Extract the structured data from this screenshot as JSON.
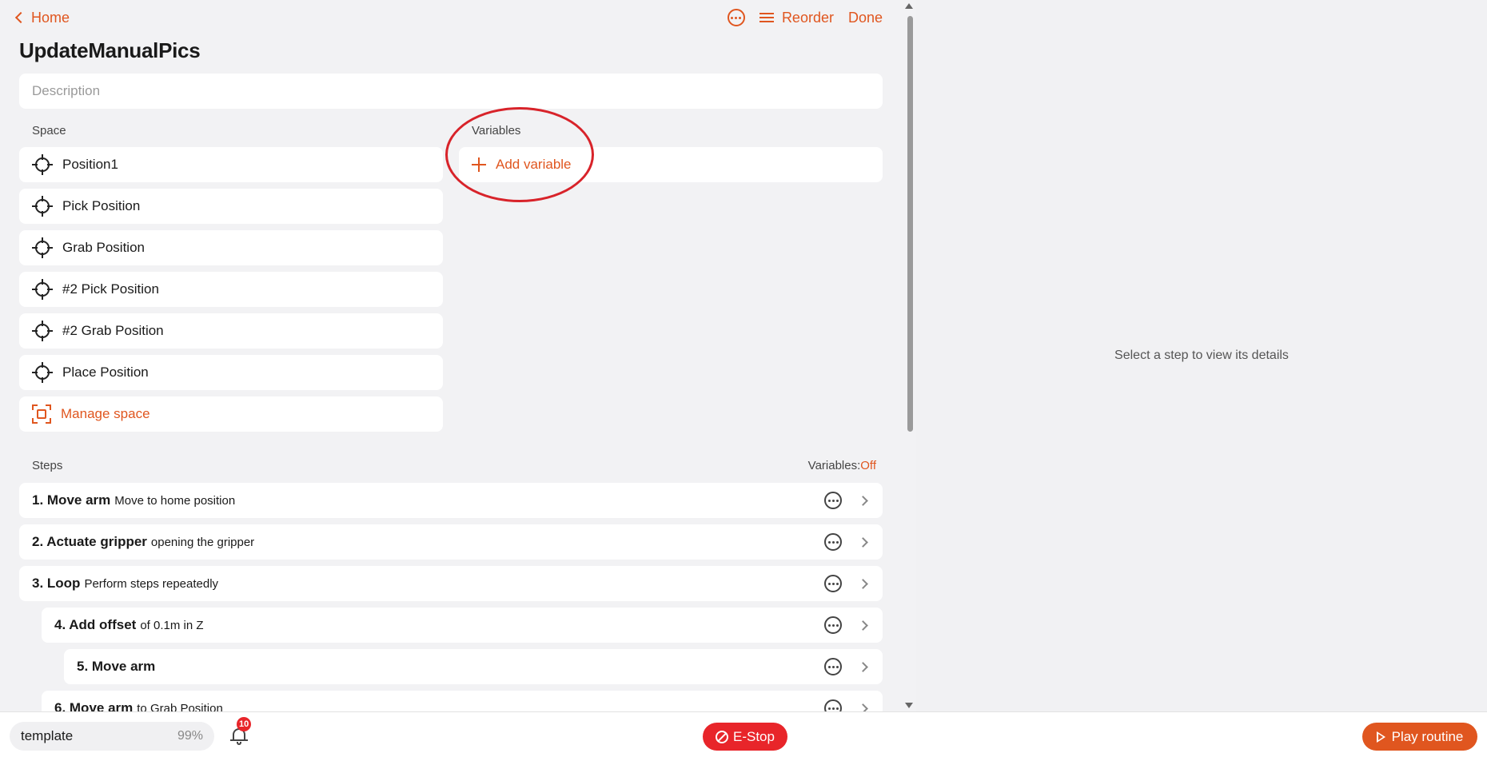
{
  "nav": {
    "home_label": "Home",
    "reorder_label": "Reorder",
    "done_label": "Done"
  },
  "routine": {
    "title": "UpdateManualPics",
    "description_placeholder": "Description"
  },
  "space": {
    "label": "Space",
    "positions": [
      "Position1",
      "Pick Position",
      "Grab Position",
      "#2 Pick Position",
      "#2 Grab Position",
      "Place Position"
    ],
    "manage_label": "Manage space"
  },
  "variables": {
    "label": "Variables",
    "add_label": "Add variable"
  },
  "steps": {
    "label": "Steps",
    "variables_toggle_label": "Variables:",
    "variables_toggle_value": "Off",
    "items": [
      {
        "title": "1. Move arm",
        "detail": "Move to home position"
      },
      {
        "title": "2. Actuate gripper",
        "detail": "opening the gripper"
      },
      {
        "title": "3. Loop",
        "detail": "Perform steps repeatedly"
      },
      {
        "title": "4. Add offset",
        "detail": "of 0.1m in Z"
      },
      {
        "title": "5. Move arm",
        "detail": ""
      },
      {
        "title": "6. Move arm",
        "detail": "to Grab Position"
      }
    ]
  },
  "details_panel": {
    "empty_text": "Select a step to view its details"
  },
  "bottom": {
    "template_label": "template",
    "template_percent": "99%",
    "notification_count": "10",
    "estop_label": "E-Stop",
    "play_label": "Play routine"
  },
  "colors": {
    "accent": "#e0561f",
    "estop": "#e8252a",
    "annotation": "#d8232a"
  }
}
